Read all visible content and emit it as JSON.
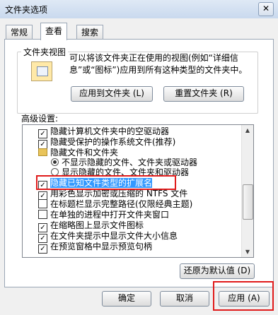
{
  "window": {
    "title": "文件夹选项",
    "close": "✕"
  },
  "tabs": [
    {
      "label": "常规"
    },
    {
      "label": "查看"
    },
    {
      "label": "搜索"
    }
  ],
  "folder_views": {
    "title": "文件夹视图",
    "description": "可以将该文件夹正在使用的视图(例如“详细信息”或“图标”)应用到所有这种类型的文件夹中。",
    "apply_button": "应用到文件夹 (L)",
    "reset_button": "重置文件夹 (R)"
  },
  "advanced": {
    "title": "高级设置:",
    "items": [
      {
        "kind": "checkbox",
        "checked": true,
        "label": "隐藏计算机文件夹中的空驱动器"
      },
      {
        "kind": "checkbox",
        "checked": true,
        "label": "隐藏受保护的操作系统文件(推荐)"
      },
      {
        "kind": "folder",
        "label": "隐藏文件和文件夹"
      },
      {
        "kind": "radio",
        "selected": true,
        "label": "不显示隐藏的文件、文件夹或驱动器"
      },
      {
        "kind": "radio",
        "selected": false,
        "label": "显示隐藏的文件、文件夹和驱动器"
      },
      {
        "kind": "checkbox",
        "checked": true,
        "label": "隐藏已知文件类型的扩展名",
        "selected": true
      },
      {
        "kind": "checkbox",
        "checked": true,
        "label": "用彩色显示加密或压缩的 NTFS 文件"
      },
      {
        "kind": "checkbox",
        "checked": false,
        "label": "在标题栏显示完整路径(仅限经典主题)"
      },
      {
        "kind": "checkbox",
        "checked": false,
        "label": "在单独的进程中打开文件夹窗口"
      },
      {
        "kind": "checkbox",
        "checked": true,
        "label": "在缩略图上显示文件图标"
      },
      {
        "kind": "checkbox",
        "checked": true,
        "label": "在文件夹提示中显示文件大小信息"
      },
      {
        "kind": "checkbox",
        "checked": true,
        "label": "在预览窗格中显示预览句柄"
      }
    ],
    "restore_button": "还原为默认值 (D)"
  },
  "footer": {
    "ok": "确定",
    "cancel": "取消",
    "apply": "应用 (A)"
  },
  "glyphs": {
    "check": "✓",
    "arrow_up": "▲",
    "arrow_down": "▼"
  },
  "colors": {
    "highlight": "#3399ff",
    "annotation_red": "#e01b1b"
  }
}
